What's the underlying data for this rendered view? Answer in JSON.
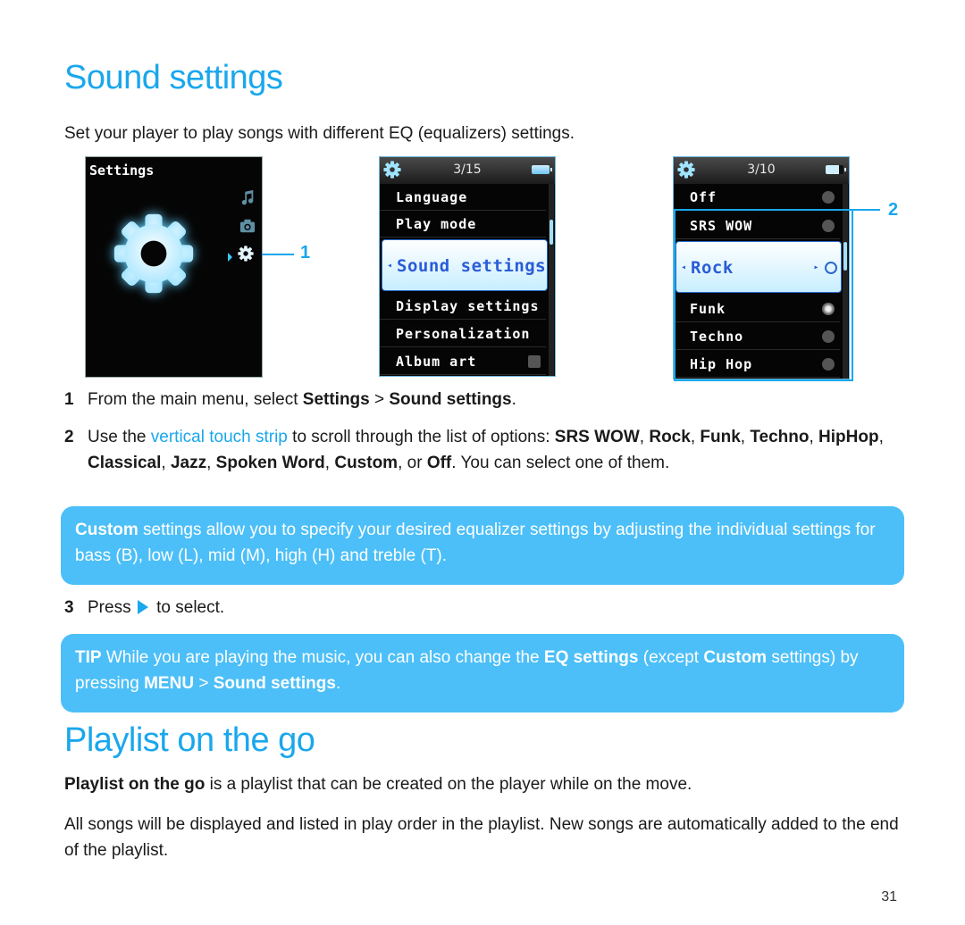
{
  "section1": {
    "title": "Sound settings",
    "intro": "Set your player to play songs with different EQ (equalizers) settings."
  },
  "screens": {
    "main_menu": {
      "title": "Settings",
      "icons": [
        "music-note-icon",
        "camera-icon",
        "gear-icon"
      ],
      "selected_icon": "gear-icon",
      "callout": "1"
    },
    "settings_menu": {
      "counter": "3/15",
      "items": [
        "Language",
        "Play mode",
        "Sound settings",
        "Display settings",
        "Personalization",
        "Album art"
      ],
      "selected": "Sound settings",
      "arrow_left": "◂",
      "arrow_right": "▸"
    },
    "sound_menu": {
      "counter": "3/10",
      "items": [
        "Off",
        "SRS WOW",
        "Rock",
        "Funk",
        "Techno",
        "Hip Hop"
      ],
      "selected": "Rock",
      "active_radio": "Funk",
      "arrow_left": "◂",
      "arrow_right": "▸",
      "callout": "2"
    }
  },
  "steps": {
    "s1": {
      "num": "1",
      "pre": "From the main menu, select ",
      "b1": "Settings",
      "sep": " > ",
      "b2": "Sound settings",
      "post": "."
    },
    "s2": {
      "num": "2",
      "pre": "Use the ",
      "link": "vertical touch strip",
      "mid": " to scroll through the list of options: ",
      "options": [
        "SRS WOW",
        "Rock",
        "Funk",
        "Techno",
        "HipHop",
        "Classical",
        "Jazz",
        "Spoken Word",
        "Custom"
      ],
      "or": ", or ",
      "last": "Off",
      "post": ". You can select one of them."
    },
    "s3": {
      "num": "3",
      "pre": "Press",
      "icon": "play-right-icon",
      "post": "to select."
    }
  },
  "note_custom": {
    "bold": "Custom",
    "text": " settings allow you to specify your desired equalizer settings by adjusting the individual settings for bass (B), low (L), mid (M), high (H) and treble (T)."
  },
  "tip": {
    "label": "TIP",
    "t1": " While you are playing the music, you can also change the ",
    "b1": "EQ settings",
    "t2": " (except ",
    "b2": "Custom",
    "t3": " settings) by pressing ",
    "b3": "MENU",
    "t4": " > ",
    "b4": "Sound settings",
    "t5": "."
  },
  "section2": {
    "title": "Playlist on the go",
    "p1_bold": "Playlist on the go",
    "p1_text": " is a playlist that can be created on the player while on the move.",
    "p2": "All songs will be displayed and listed in play order in the playlist. New songs are automatically added to the end of the playlist."
  },
  "page_number": "31",
  "colors": {
    "accent": "#1aa7ec",
    "callout_bg": "#4cbff8",
    "highlight_text": "#2a5cd8"
  }
}
